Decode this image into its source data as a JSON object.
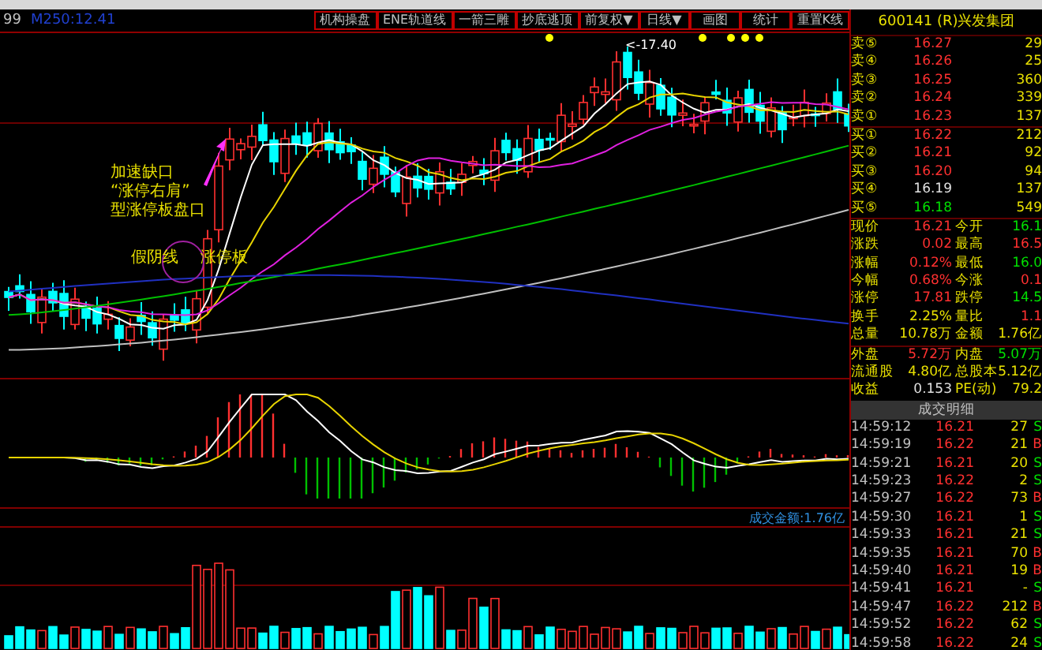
{
  "header": {
    "left_text": "99",
    "ma_text": "M250:12.41",
    "buttons": [
      "机构操盘",
      "ENE轨道线",
      "一箭三雕",
      "抄底逃顶",
      "前复权▼",
      "日线▼",
      "画图",
      "统计",
      "重置K线"
    ]
  },
  "chart": {
    "peak_label": "<-17.40",
    "annotations": [
      {
        "text": "加速缺口",
        "kind": "note"
      },
      {
        "text": "“涨停右肩”",
        "kind": "note"
      },
      {
        "text": "型涨停板盘口",
        "kind": "note"
      },
      {
        "text": "假阴线",
        "kind": "label"
      },
      {
        "text": "涨停板",
        "kind": "label"
      }
    ],
    "amount_label": "成交金额:1.76亿"
  },
  "quote": {
    "title": "600141  (R)兴发集团",
    "order_book": [
      {
        "label": "卖⑤",
        "price": "16.27",
        "volume": "29",
        "color": "#ff3030"
      },
      {
        "label": "卖④",
        "price": "16.26",
        "volume": "25",
        "color": "#ff3030"
      },
      {
        "label": "卖③",
        "price": "16.25",
        "volume": "360",
        "color": "#ff3030"
      },
      {
        "label": "卖②",
        "price": "16.24",
        "volume": "339",
        "color": "#ff3030"
      },
      {
        "label": "卖①",
        "price": "16.23",
        "volume": "137",
        "color": "#ff3030"
      },
      {
        "label": "买①",
        "price": "16.22",
        "volume": "212",
        "color": "#ff3030"
      },
      {
        "label": "买②",
        "price": "16.21",
        "volume": "92",
        "color": "#ff3030"
      },
      {
        "label": "买③",
        "price": "16.20",
        "volume": "94",
        "color": "#ff3030"
      },
      {
        "label": "买④",
        "price": "16.19",
        "volume": "137",
        "color": "#e0e0e0"
      },
      {
        "label": "买⑤",
        "price": "16.18",
        "volume": "549",
        "color": "#00e000"
      }
    ],
    "stats": [
      {
        "left": {
          "label": "现价",
          "value": "16.21",
          "color": "#ff3030"
        },
        "right": {
          "label": "今开",
          "value": "16.1",
          "color": "#00e000"
        }
      },
      {
        "left": {
          "label": "涨跌",
          "value": "0.02",
          "color": "#ff3030"
        },
        "right": {
          "label": "最高",
          "value": "16.5",
          "color": "#ff3030"
        }
      },
      {
        "left": {
          "label": "涨幅",
          "value": "0.12%",
          "color": "#ff3030"
        },
        "right": {
          "label": "最低",
          "value": "16.0",
          "color": "#00e000"
        }
      },
      {
        "left": {
          "label": "今幅",
          "value": "0.68%",
          "color": "#ff3030"
        },
        "right": {
          "label": "今涨",
          "value": "0.1",
          "color": "#ff3030"
        }
      },
      {
        "left": {
          "label": "涨停",
          "value": "17.81",
          "color": "#ff3030"
        },
        "right": {
          "label": "跌停",
          "value": "14.5",
          "color": "#00e000"
        }
      },
      {
        "left": {
          "label": "换手",
          "value": "2.25%",
          "color": "#e8e000"
        },
        "right": {
          "label": "量比",
          "value": "1.1",
          "color": "#ff3030"
        }
      },
      {
        "left": {
          "label": "总量",
          "value": "10.78万",
          "color": "#e8e000"
        },
        "right": {
          "label": "金额",
          "value": "1.76亿",
          "color": "#e8e000"
        }
      },
      {
        "left": {
          "label": "外盘",
          "value": "5.72万",
          "color": "#ff3030"
        },
        "right": {
          "label": "内盘",
          "value": "5.07万",
          "color": "#00e000"
        }
      },
      {
        "left": {
          "label": "流通股",
          "value": "4.80亿",
          "color": "#e8e000"
        },
        "right": {
          "label": "总股本",
          "value": "5.12亿",
          "color": "#e8e000"
        }
      },
      {
        "left": {
          "label": "收益",
          "value": "0.153",
          "color": "#e0e0e0"
        },
        "right": {
          "label": "PE(动)",
          "value": "79.2",
          "color": "#e8e000"
        }
      }
    ],
    "ticks_title": "成交明细",
    "ticks": [
      {
        "time": "14:59:12",
        "price": "16.21",
        "volume": "27",
        "side": "S"
      },
      {
        "time": "14:59:19",
        "price": "16.22",
        "volume": "21",
        "side": "B"
      },
      {
        "time": "14:59:21",
        "price": "16.21",
        "volume": "20",
        "side": "S"
      },
      {
        "time": "14:59:23",
        "price": "16.22",
        "volume": "2",
        "side": "S"
      },
      {
        "time": "14:59:27",
        "price": "16.22",
        "volume": "73",
        "side": "B"
      },
      {
        "time": "14:59:30",
        "price": "16.21",
        "volume": "1",
        "side": "S"
      },
      {
        "time": "14:59:33",
        "price": "16.21",
        "volume": "21",
        "side": "S"
      },
      {
        "time": "14:59:35",
        "price": "16.21",
        "volume": "70",
        "side": "B"
      },
      {
        "time": "14:59:40",
        "price": "16.21",
        "volume": "19",
        "side": "B"
      },
      {
        "time": "14:59:41",
        "price": "16.21",
        "volume": "-",
        "side": "S"
      },
      {
        "time": "14:59:47",
        "price": "16.22",
        "volume": "212",
        "side": "B"
      },
      {
        "time": "14:59:52",
        "price": "16.22",
        "volume": "62",
        "side": "S"
      },
      {
        "time": "14:59:58",
        "price": "16.22",
        "volume": "24",
        "side": "S"
      }
    ]
  }
}
